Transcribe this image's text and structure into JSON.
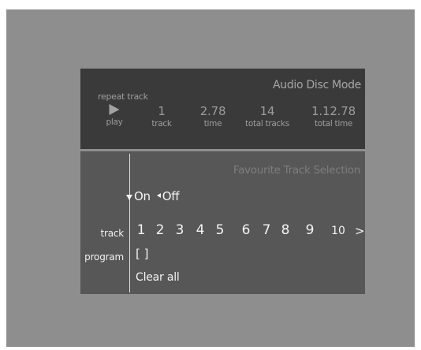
{
  "status": {
    "mode_title": "Audio Disc Mode",
    "repeat_label": "repeat track",
    "play_label": "play",
    "play_icon": "play-icon",
    "track_value": "1",
    "track_label": "track",
    "time_value": "2.78",
    "time_label": "time",
    "total_tracks_value": "14",
    "total_tracks_label": "total tracks",
    "total_time_value": "1.12.78",
    "total_time_label": "total time"
  },
  "selection": {
    "title": "Favourite Track Selection",
    "on_label": "On",
    "off_label": "Off",
    "track_row_label": "track",
    "program_row_label": "program",
    "tracks": [
      "1",
      "2",
      "3",
      "4",
      "5",
      "6",
      "7",
      "8",
      "9",
      "10"
    ],
    "more_label": ">",
    "program_value": "[ ]",
    "clear_all_label": "Clear all"
  },
  "colors": {
    "background": "#8e8e8e",
    "status_panel": "#3a3a3a",
    "selection_panel": "#575757"
  }
}
